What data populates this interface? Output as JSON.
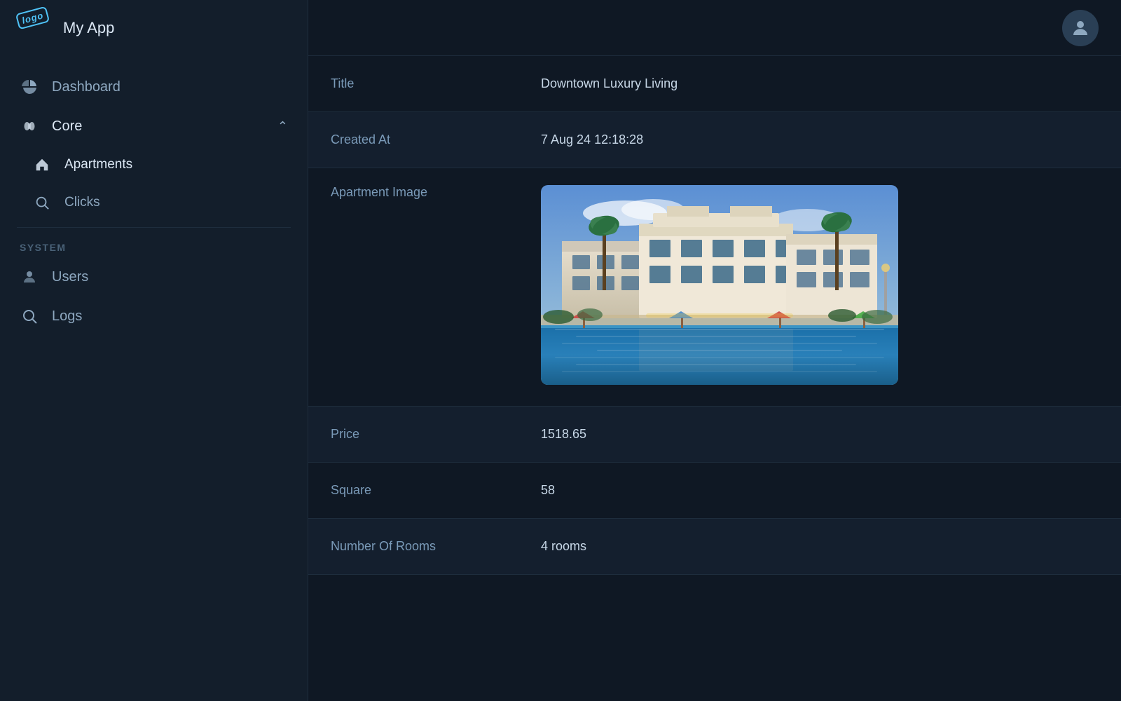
{
  "app": {
    "logo_badge": "logo",
    "title": "My App"
  },
  "topbar": {
    "user_icon": "person"
  },
  "sidebar": {
    "nav_items": [
      {
        "id": "dashboard",
        "label": "Dashboard",
        "icon": "chart-pie"
      },
      {
        "id": "core",
        "label": "Core",
        "icon": "brain",
        "expandable": true,
        "expanded": true
      },
      {
        "id": "apartments",
        "label": "Apartments",
        "icon": "home",
        "sub": true
      },
      {
        "id": "clicks",
        "label": "Clicks",
        "icon": "search",
        "sub": true
      }
    ],
    "system_label": "SYSTEM",
    "system_items": [
      {
        "id": "users",
        "label": "Users",
        "icon": "person"
      },
      {
        "id": "logs",
        "label": "Logs",
        "icon": "search"
      }
    ]
  },
  "detail": {
    "rows": [
      {
        "id": "title",
        "label": "Title",
        "value": "Downtown Luxury Living",
        "highlighted": false
      },
      {
        "id": "created_at",
        "label": "Created At",
        "value": "7 Aug 24 12:18:28",
        "highlighted": true
      },
      {
        "id": "apartment_image",
        "label": "Apartment Image",
        "value": "",
        "highlighted": false,
        "is_image": true
      },
      {
        "id": "price",
        "label": "Price",
        "value": "1518.65",
        "highlighted": true
      },
      {
        "id": "square",
        "label": "Square",
        "value": "58",
        "highlighted": false
      },
      {
        "id": "number_of_rooms",
        "label": "Number Of Rooms",
        "value": "4 rooms",
        "highlighted": true
      }
    ]
  }
}
